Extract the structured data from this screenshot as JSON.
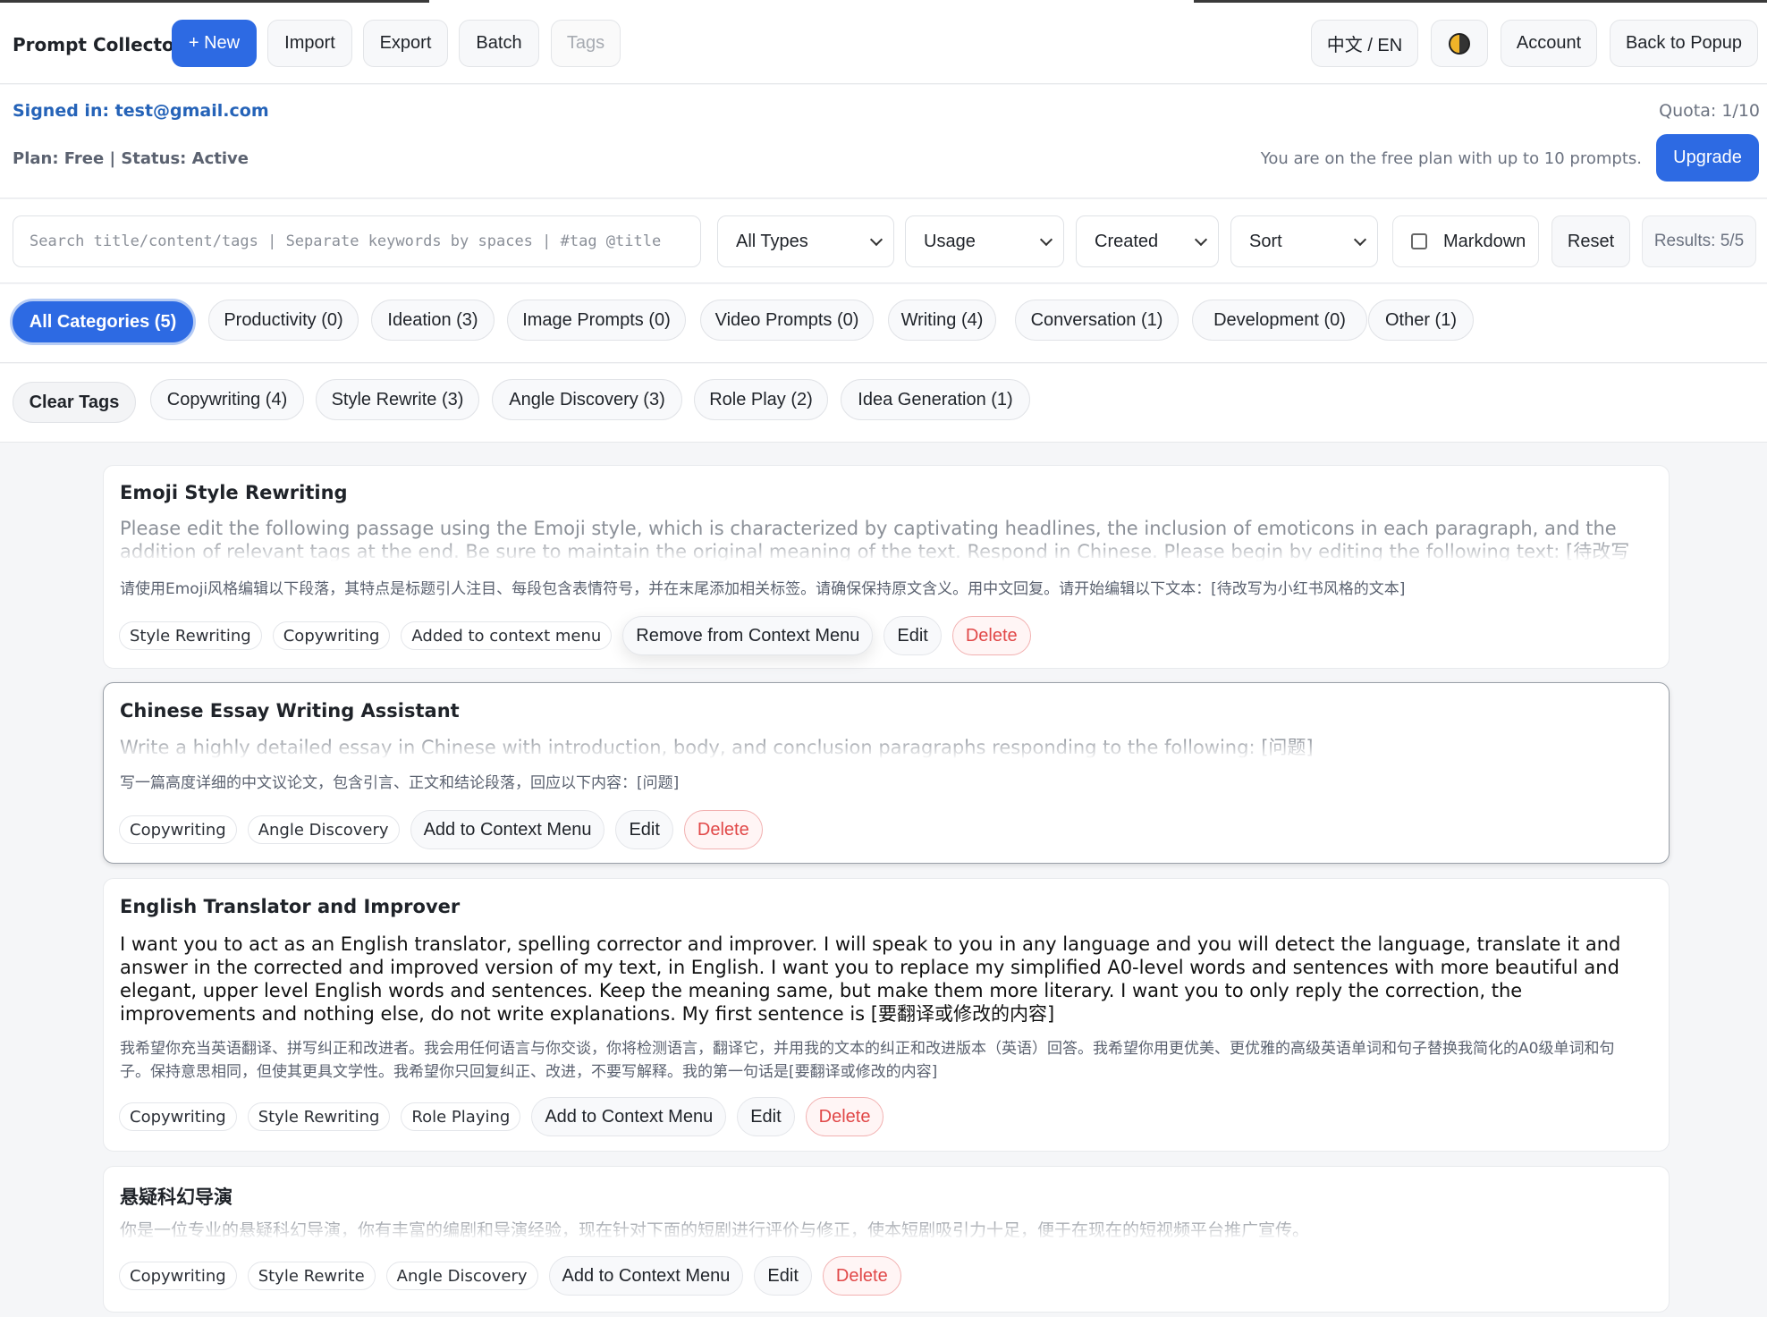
{
  "app": {
    "title": "Prompt Collector"
  },
  "toolbar": {
    "new_label": "+ New",
    "import_label": "Import",
    "export_label": "Export",
    "batch_label": "Batch",
    "tags_label": "Tags",
    "lang_label": "中文 / EN",
    "theme_icon": "theme-toggle-icon",
    "account_label": "Account",
    "back_label": "Back to Popup"
  },
  "account": {
    "signed_in": "Signed in: test@gmail.com",
    "plan_status": "Plan: Free | Status: Active",
    "quota": "Quota: 1/10",
    "free_note": "You are on the free plan with up to 10 prompts.",
    "upgrade_label": "Upgrade"
  },
  "filters": {
    "search_placeholder": "Search title/content/tags | Separate keywords by spaces | #tag @title",
    "type_value": "All Types",
    "usage_value": "Usage",
    "created_value": "Created",
    "sort_value": "Sort",
    "markdown_label": "Markdown",
    "reset_label": "Reset",
    "results": "Results: 5/5"
  },
  "categories": [
    "All Categories (5)",
    "Productivity (0)",
    "Ideation (3)",
    "Image Prompts (0)",
    "Video Prompts (0)",
    "Writing (4)",
    "Conversation (1)",
    "Development (0)",
    "Other (1)"
  ],
  "tag_filters": {
    "clear_label": "Clear Tags",
    "items": [
      "Copywriting (4)",
      "Style Rewrite (3)",
      "Angle Discovery (3)",
      "Role Play (2)",
      "Idea Generation (1)"
    ]
  },
  "prompts": [
    {
      "title": "Emoji Style Rewriting",
      "body": "Please edit the following passage using the Emoji style, which is characterized by captivating headlines, the inclusion of emoticons in each paragraph, and the addition of relevant tags at the end. Be sure to maintain the original meaning of the text. Respond in Chinese. Please begin by editing the following text: [待改写为小红书风格的文本]",
      "zh": "请使用Emoji风格编辑以下段落，其特点是标题引人注目、每段包含表情符号，并在末尾添加相关标签。请确保保持原文含义。用中文回复。请开始编辑以下文本：[待改写为小红书风格的文本]",
      "tags": [
        "Style Rewriting",
        "Copywriting",
        "Added to context menu"
      ],
      "context_action": "Remove from Context Menu",
      "edit_label": "Edit",
      "delete_label": "Delete"
    },
    {
      "title": "Chinese Essay Writing Assistant",
      "body": "Write a highly detailed essay in Chinese with introduction, body, and conclusion paragraphs responding to the following: [问题]",
      "zh": "写一篇高度详细的中文议论文，包含引言、正文和结论段落，回应以下内容：[问题]",
      "tags": [
        "Copywriting",
        "Angle Discovery"
      ],
      "context_action": "Add to Context Menu",
      "edit_label": "Edit",
      "delete_label": "Delete"
    },
    {
      "title": "English Translator and Improver",
      "body": "I want you to act as an English translator, spelling corrector and improver. I will speak to you in any language and you will detect the language, translate it and answer in the corrected and improved version of my text, in English. I want you to replace my simplified A0-level words and sentences with more beautiful and elegant, upper level English words and sentences. Keep the meaning same, but make them more literary. I want you to only reply the correction, the improvements and nothing else, do not write explanations. My first sentence is [要翻译或修改的内容]",
      "zh": "我希望你充当英语翻译、拼写纠正和改进者。我会用任何语言与你交谈，你将检测语言，翻译它，并用我的文本的纠正和改进版本（英语）回答。我希望你用更优美、更优雅的高级英语单词和句子替换我简化的A0级单词和句子。保持意思相同，但使其更具文学性。我希望你只回复纠正、改进，不要写解释。我的第一句话是[要翻译或修改的内容]",
      "tags": [
        "Copywriting",
        "Style Rewriting",
        "Role Playing"
      ],
      "context_action": "Add to Context Menu",
      "edit_label": "Edit",
      "delete_label": "Delete"
    },
    {
      "title": "悬疑科幻导演",
      "body": "你是一位专业的悬疑科幻导演，你有丰富的编剧和导演经验，现在针对下面的短剧进行评价与修正，使本短剧吸引力十足，便于在现在的短视频平台推广宣传。",
      "zh": "",
      "tags": [
        "Copywriting",
        "Style Rewrite",
        "Angle Discovery"
      ],
      "context_action": "Add to Context Menu",
      "edit_label": "Edit",
      "delete_label": "Delete"
    }
  ]
}
